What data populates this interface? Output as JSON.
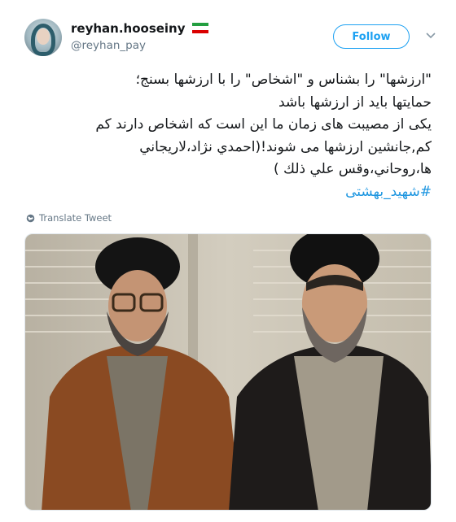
{
  "user": {
    "display_name": "reyhan.hooseiny",
    "handle": "@reyhan_pay",
    "flag_icon": "iran-flag-icon"
  },
  "follow_button": {
    "label": "Follow"
  },
  "tweet": {
    "lines": [
      "\"ارزشها\" را بشناس و \"اشخاص\" را با ارزشها بسنج؛",
      "حمایتها باید از ارزشها باشد",
      "یکی از مصیبت های زمان ما این است که اشخاص دارند کم",
      "کم,جانشین ارزشها می شوند!(احمدي نژاد،لاريجاني",
      "ها،روحاني،وقس علي ذلك )"
    ],
    "hashtag": "#شهید_بهشتی"
  },
  "translate": {
    "label": "Translate Tweet"
  },
  "colors": {
    "accent": "#1da1f2",
    "hashtag": "#1b95e0",
    "secondary_text": "#657786"
  },
  "icons": {
    "more": "chevron-down-icon",
    "globe": "globe-icon"
  }
}
